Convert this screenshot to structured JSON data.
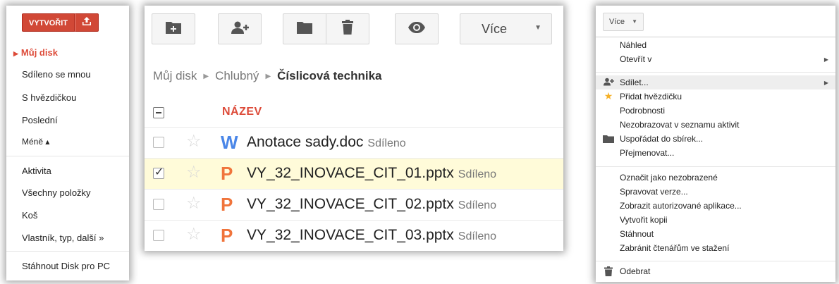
{
  "sidebar": {
    "create_label": "VYTVOŘIT",
    "items": [
      {
        "label": "Můj disk",
        "active": true
      },
      {
        "label": "Sdíleno se mnou"
      },
      {
        "label": "S hvězdičkou"
      },
      {
        "label": "Poslední"
      },
      {
        "label": "Méně ▴"
      },
      {
        "label": "Aktivita"
      },
      {
        "label": "Všechny položky"
      },
      {
        "label": "Koš"
      },
      {
        "label": "Vlastník, typ, další »"
      }
    ],
    "download_label": "Stáhnout Disk pro PC"
  },
  "toolbar": {
    "icons": [
      "new-folder-icon",
      "add-person-icon",
      "folder-icon",
      "trash-icon",
      "eye-icon"
    ],
    "more_label": "Více"
  },
  "breadcrumb": {
    "items": [
      "Můj disk",
      "Chlubný",
      "Číslicová technika"
    ]
  },
  "files": {
    "header": "NÁZEV",
    "rows": [
      {
        "icon": "W",
        "icon_color": "#4a86e8",
        "name": "Anotace sady.doc",
        "badge": "Sdíleno",
        "selected": false
      },
      {
        "icon": "P",
        "icon_color": "#f0743b",
        "name": "VY_32_INOVACE_CIT_01.pptx",
        "badge": "Sdíleno",
        "selected": true
      },
      {
        "icon": "P",
        "icon_color": "#f0743b",
        "name": "VY_32_INOVACE_CIT_02.pptx",
        "badge": "Sdíleno",
        "selected": false
      },
      {
        "icon": "P",
        "icon_color": "#f0743b",
        "name": "VY_32_INOVACE_CIT_03.pptx",
        "badge": "Sdíleno",
        "selected": false
      }
    ]
  },
  "menu": {
    "button_label": "Více",
    "items": [
      {
        "label": "Náhled"
      },
      {
        "label": "Otevřít v",
        "submenu": true
      },
      {
        "label": "Sdílet...",
        "submenu": true,
        "icon": "share-person-icon",
        "highlight": true
      },
      {
        "label": "Přidat hvězdičku",
        "icon": "star-icon"
      },
      {
        "label": "Podrobnosti"
      },
      {
        "label": "Nezobrazovat v seznamu aktivit"
      },
      {
        "label": "Uspořádat do sbírek...",
        "icon": "folder-icon"
      },
      {
        "label": "Přejmenovat..."
      },
      {
        "label": "Označit jako nezobrazené"
      },
      {
        "label": "Spravovat verze..."
      },
      {
        "label": "Zobrazit autorizované aplikace..."
      },
      {
        "label": "Vytvořit kopii"
      },
      {
        "label": "Stáhnout"
      },
      {
        "label": "Zabránit čtenářům ve stažení"
      },
      {
        "label": "Odebrat",
        "icon": "trash-icon"
      }
    ]
  }
}
